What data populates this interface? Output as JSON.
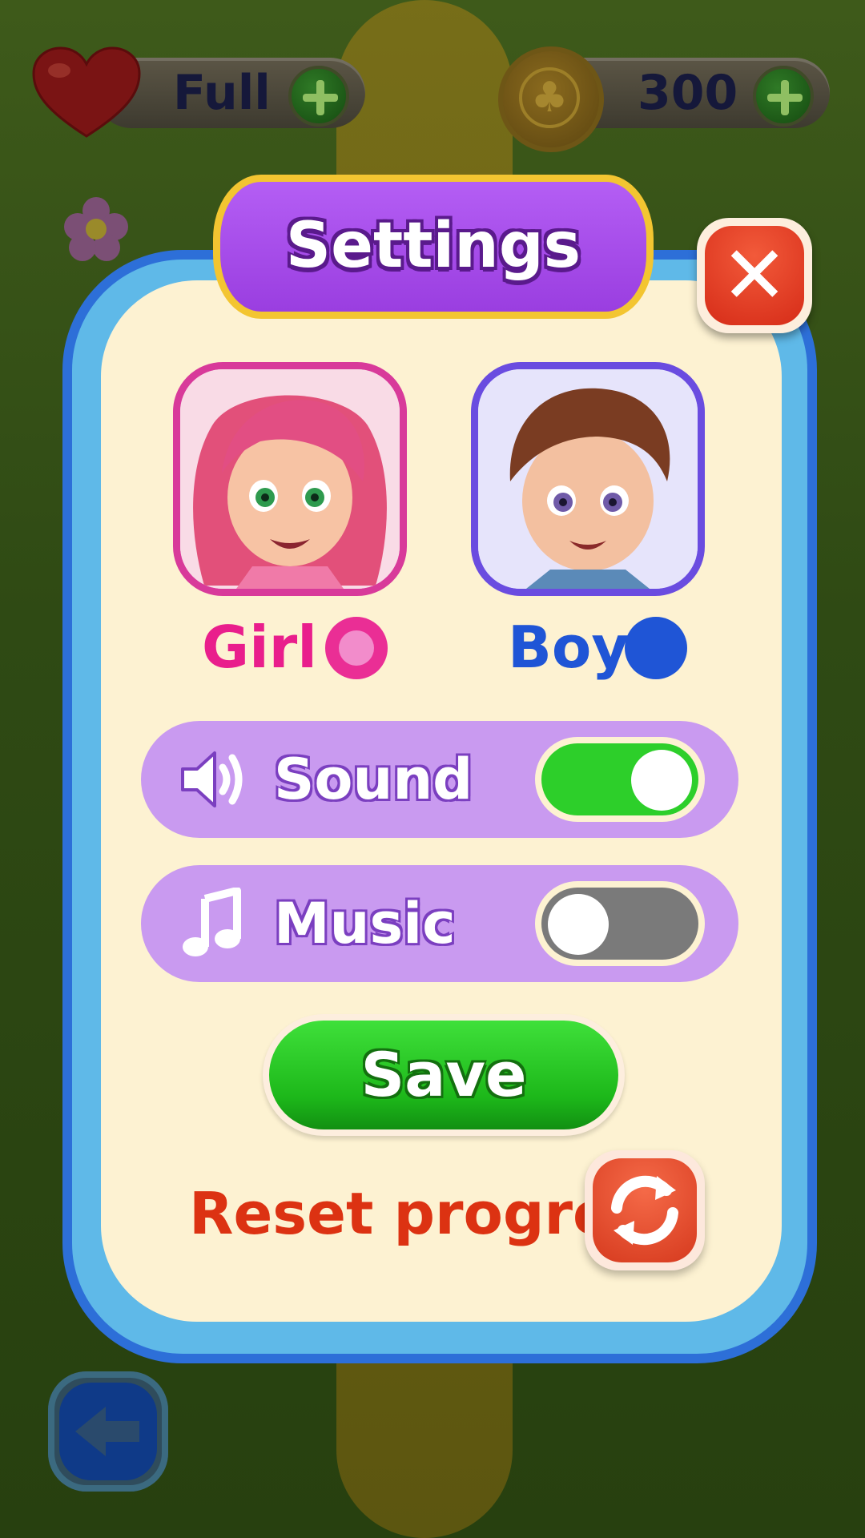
{
  "hud": {
    "lives_label": "Full",
    "coins_value": "300"
  },
  "settings": {
    "title": "Settings",
    "character": {
      "girl_label": "Girl",
      "boy_label": "Boy",
      "selected": "boy"
    },
    "sound": {
      "label": "Sound",
      "enabled": true
    },
    "music": {
      "label": "Music",
      "enabled": false
    },
    "save_label": "Save",
    "reset_label": "Reset progress"
  },
  "colors": {
    "girl": "#E91E8C",
    "boy": "#1F55D6",
    "toggle_on": "#2DCF2A",
    "toggle_off": "#7A7A7A",
    "panel_border": "#2D6FD8",
    "title_banner": "#A94CEA",
    "reset_text": "#DC3212"
  }
}
